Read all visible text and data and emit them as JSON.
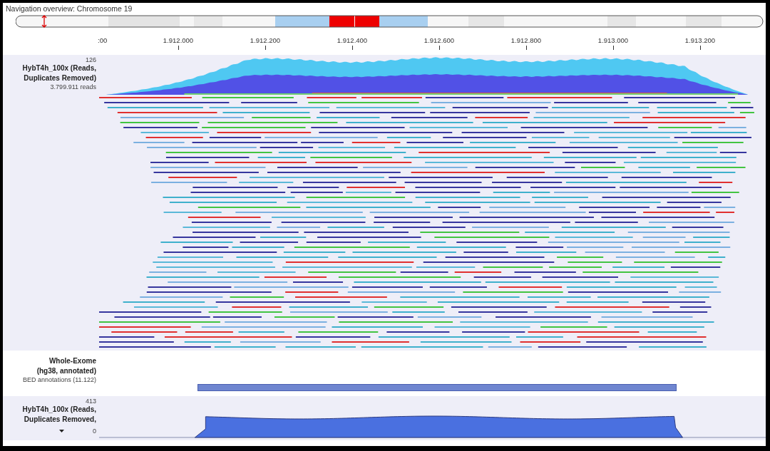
{
  "navigation": {
    "title": "Navigation overview: Chromosome 19"
  },
  "ruler": {
    "ticks": [
      ":00",
      "1.912.000",
      "1.912.200",
      "1.912.400",
      "1.912.600",
      "1.912.800",
      "1.913.000",
      "1.913.200"
    ]
  },
  "tracks": [
    {
      "kind": "reads",
      "max": "126",
      "name_lines": [
        "HybT4h_100x (Reads,",
        "Duplicates Removed)"
      ],
      "info": "3.799.911 reads"
    },
    {
      "kind": "annotation",
      "name_lines": [
        "Whole-Exome",
        "(hg38, annotated)"
      ],
      "info": "BED annotations (11.122)"
    },
    {
      "kind": "coverage",
      "max": "413",
      "name_lines": [
        "HybT4h_100x (Reads,",
        "Duplicates Removed,"
      ],
      "min": "0"
    }
  ]
}
